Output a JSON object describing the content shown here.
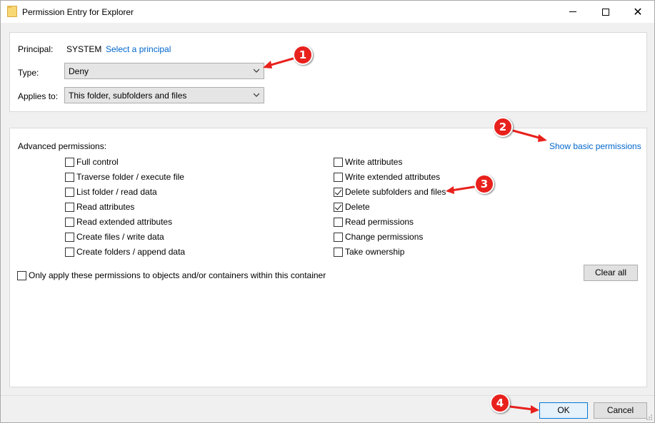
{
  "window": {
    "title": "Permission Entry for Explorer",
    "minimize_icon": "minimize-icon",
    "maximize_icon": "maximize-icon",
    "close_icon": "close-icon"
  },
  "principal": {
    "label": "Principal:",
    "value": "SYSTEM",
    "select_link": "Select a principal"
  },
  "type": {
    "label": "Type:",
    "value": "Deny"
  },
  "applies_to": {
    "label": "Applies to:",
    "value": "This folder, subfolders and files"
  },
  "advanced": {
    "heading": "Advanced permissions:",
    "show_basic_link": "Show basic permissions",
    "left_permissions": [
      {
        "label": "Full control",
        "checked": false
      },
      {
        "label": "Traverse folder / execute file",
        "checked": false
      },
      {
        "label": "List folder / read data",
        "checked": false
      },
      {
        "label": "Read attributes",
        "checked": false
      },
      {
        "label": "Read extended attributes",
        "checked": false
      },
      {
        "label": "Create files / write data",
        "checked": false
      },
      {
        "label": "Create folders / append data",
        "checked": false
      }
    ],
    "right_permissions": [
      {
        "label": "Write attributes",
        "checked": false
      },
      {
        "label": "Write extended attributes",
        "checked": false
      },
      {
        "label": "Delete subfolders and files",
        "checked": true
      },
      {
        "label": "Delete",
        "checked": true
      },
      {
        "label": "Read permissions",
        "checked": false
      },
      {
        "label": "Change permissions",
        "checked": false
      },
      {
        "label": "Take ownership",
        "checked": false
      }
    ],
    "only_apply_label": "Only apply these permissions to objects and/or containers within this container",
    "only_apply_checked": false,
    "clear_all": "Clear all"
  },
  "footer": {
    "ok": "OK",
    "cancel": "Cancel"
  },
  "annotations": {
    "badge_1": "1",
    "badge_2": "2",
    "badge_3": "3",
    "badge_4": "4",
    "color": "#e8211d"
  }
}
